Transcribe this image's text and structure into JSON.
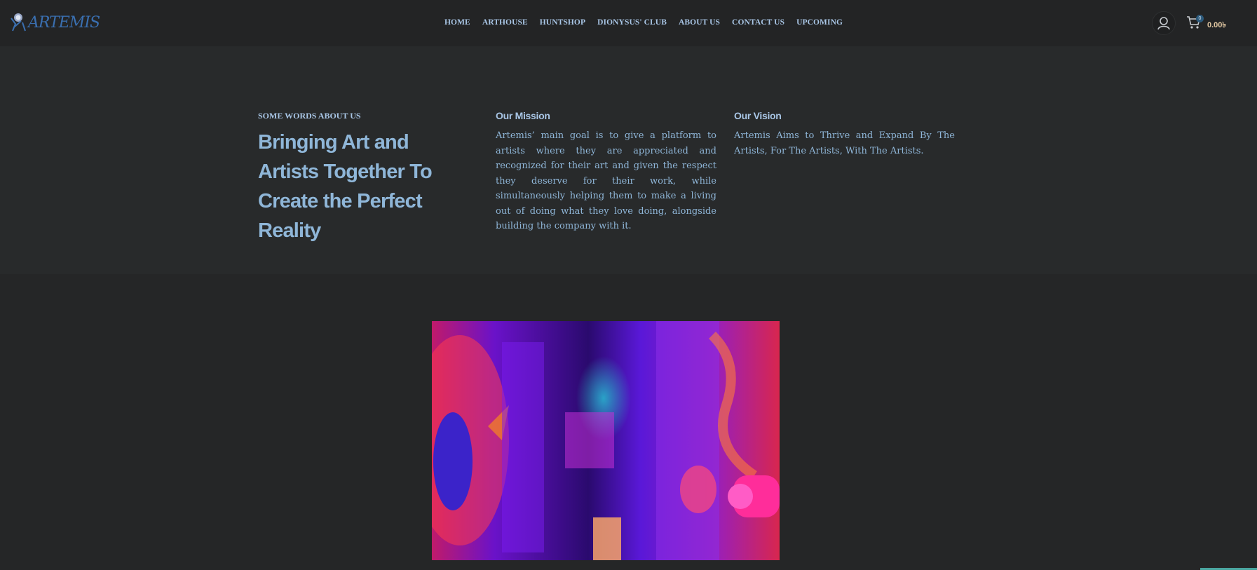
{
  "header": {
    "logo_text": "ARTEMIS",
    "nav": [
      {
        "label": "HOME"
      },
      {
        "label": "ARTHOUSE"
      },
      {
        "label": "HUNTSHOP"
      },
      {
        "label": "DIONYSUS' CLUB"
      },
      {
        "label": "ABOUT US"
      },
      {
        "label": "CONTACT US"
      },
      {
        "label": "UPCOMING"
      }
    ],
    "cart_count": "0",
    "cart_total": "0.00৳"
  },
  "about": {
    "kicker": "SOME WORDS ABOUT US",
    "heading": "Bringing Art and Artists Together To Create the Perfect Reality",
    "mission": {
      "title": "Our Mission",
      "text": "Artemis’ main goal is to give a platform to artists where they are appreciated and recognized for their art and given the respect they deserve for their work, while simultaneously helping them to make a living out of doing what they love doing, alongside building the company with it."
    },
    "vision": {
      "title": "Our Vision",
      "text": "Artemis Aims to Thrive and Expand By The Artists, For The Artists, With The Artists."
    }
  },
  "colors": {
    "background": "#252627",
    "accent_text": "#8fb6d8",
    "cart_total": "#e3c9a3"
  },
  "icons": {
    "user": "user-icon",
    "cart": "cart-icon"
  }
}
